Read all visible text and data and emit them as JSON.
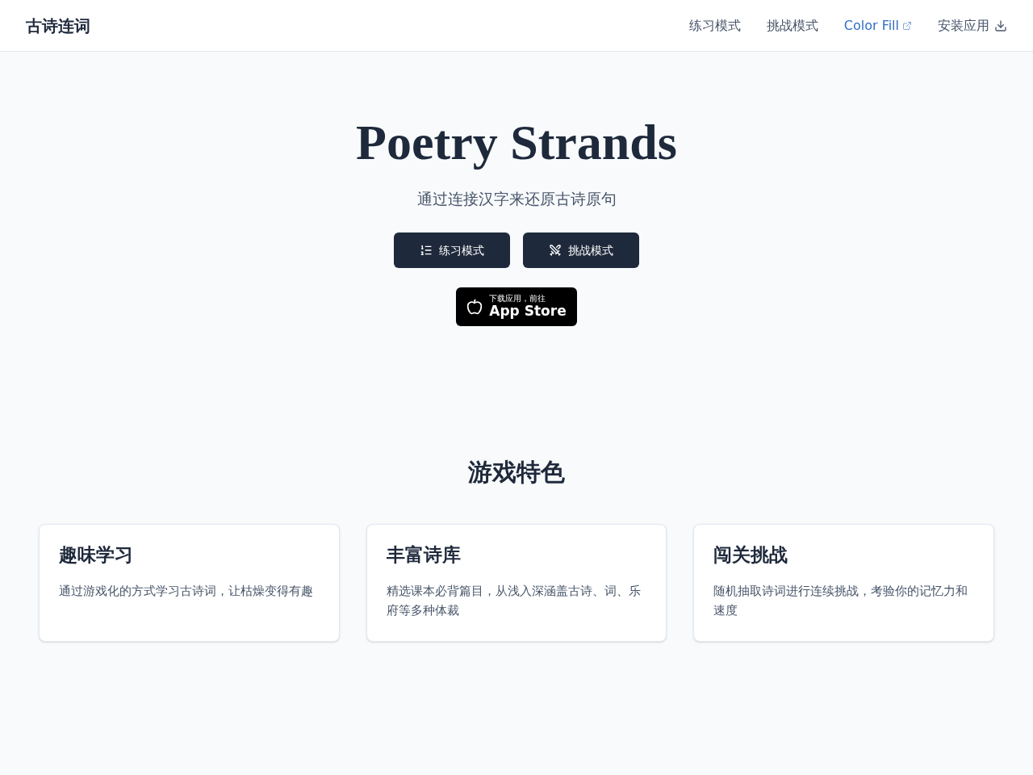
{
  "brand": "古诗连词",
  "nav": [
    {
      "label": "练习模式",
      "kind": "plain"
    },
    {
      "label": "挑战模式",
      "kind": "plain"
    },
    {
      "label": "Color Fill",
      "kind": "external"
    },
    {
      "label": "安装应用",
      "kind": "download"
    }
  ],
  "hero": {
    "title": "Poetry Strands",
    "subtitle": "通过连接汉字来还原古诗原句",
    "buttons": [
      {
        "label": "练习模式",
        "kind": "list"
      },
      {
        "label": "挑战模式",
        "kind": "swords"
      }
    ],
    "store_badge": {
      "caption": "下载应用，前往",
      "name": "App Store"
    }
  },
  "features": {
    "title": "游戏特色",
    "cards": [
      {
        "title": "趣味学习",
        "text": "通过游戏化的方式学习古诗词，让枯燥变得有趣"
      },
      {
        "title": "丰富诗库",
        "text": "精选课本必背篇目，从浅入深涵盖古诗、词、乐府等多种体裁"
      },
      {
        "title": "闯关挑战",
        "text": "随机抽取诗词进行连续挑战，考验你的记忆力和速度"
      }
    ]
  }
}
